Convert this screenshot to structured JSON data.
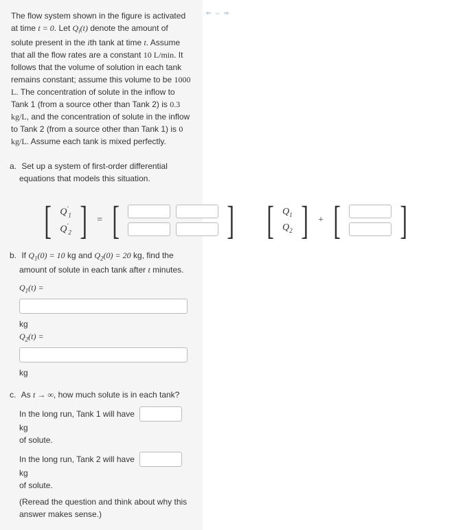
{
  "intro": {
    "p1a": "The flow system shown in the figure is activated at time ",
    "t0": "t = 0",
    "p1b": ". Let ",
    "Qi": "Q",
    "Qi_sub": "i",
    "Qi_arg": "(t)",
    "p1c": " denote the amount of solute present in the ",
    "ith": "i",
    "p1d": "th tank at time ",
    "tvar": "t",
    "p1e": ". Assume that all the flow rates are a constant ",
    "rate": "10 L/min",
    "p1f": ". It follows that the volume of solution in each tank remains constant; assume this volume to be ",
    "vol": "1000 L",
    "p1g": ". The concentration of solute in the inflow to Tank 1 (from a source other than Tank 2) is ",
    "c1": "0.3 kg/L",
    "p1h": ", and the concentration of solute in the inflow to Tank 2 (from a source other than Tank 1) is ",
    "c2": "0 kg/L",
    "p1i": ". Assume each tank is mixed perfectly."
  },
  "parts": {
    "a": {
      "label": "a.",
      "text": "Set up a system of first-order differential equations that models this situation.",
      "Q1p": "Q",
      "Q1p_sub": "1",
      "prime": "′",
      "Q2p": "Q",
      "Q2p_sub": "2",
      "eq": "=",
      "Q1": "Q",
      "Q1_sub": "1",
      "Q2": "Q",
      "Q2_sub": "2",
      "plus": "+"
    },
    "b": {
      "label": "b.",
      "textA": "If ",
      "Q10": "Q",
      "Q10_sub": "1",
      "Q10_arg": "(0) = 10",
      "kg1": " kg",
      "and": " and ",
      "Q20": "Q",
      "Q20_sub": "2",
      "Q20_arg": "(0) = 20",
      "kg2": " kg",
      "textB": ", find the amount of solute in each tank after ",
      "tvar": "t",
      "textC": " minutes.",
      "Q1t": "Q",
      "Q1t_sub": "1",
      "Q1t_arg": "(t) =",
      "kg": "kg",
      "Q2t": "Q",
      "Q2t_sub": "2",
      "Q2t_arg": "(t) ="
    },
    "c": {
      "label": "c.",
      "textA": "As ",
      "tinf": "t → ∞",
      "textB": ", how much solute is in each tank?",
      "line1a": "In the long run, Tank 1 will have",
      "kg": "kg",
      "ofsolute": "of solute.",
      "line2a": "In the long run, Tank 2 will have",
      "reread": "(Reread the question and think about why this answer makes sense.)"
    }
  },
  "icons": "⇐ ⇔ ⇒"
}
